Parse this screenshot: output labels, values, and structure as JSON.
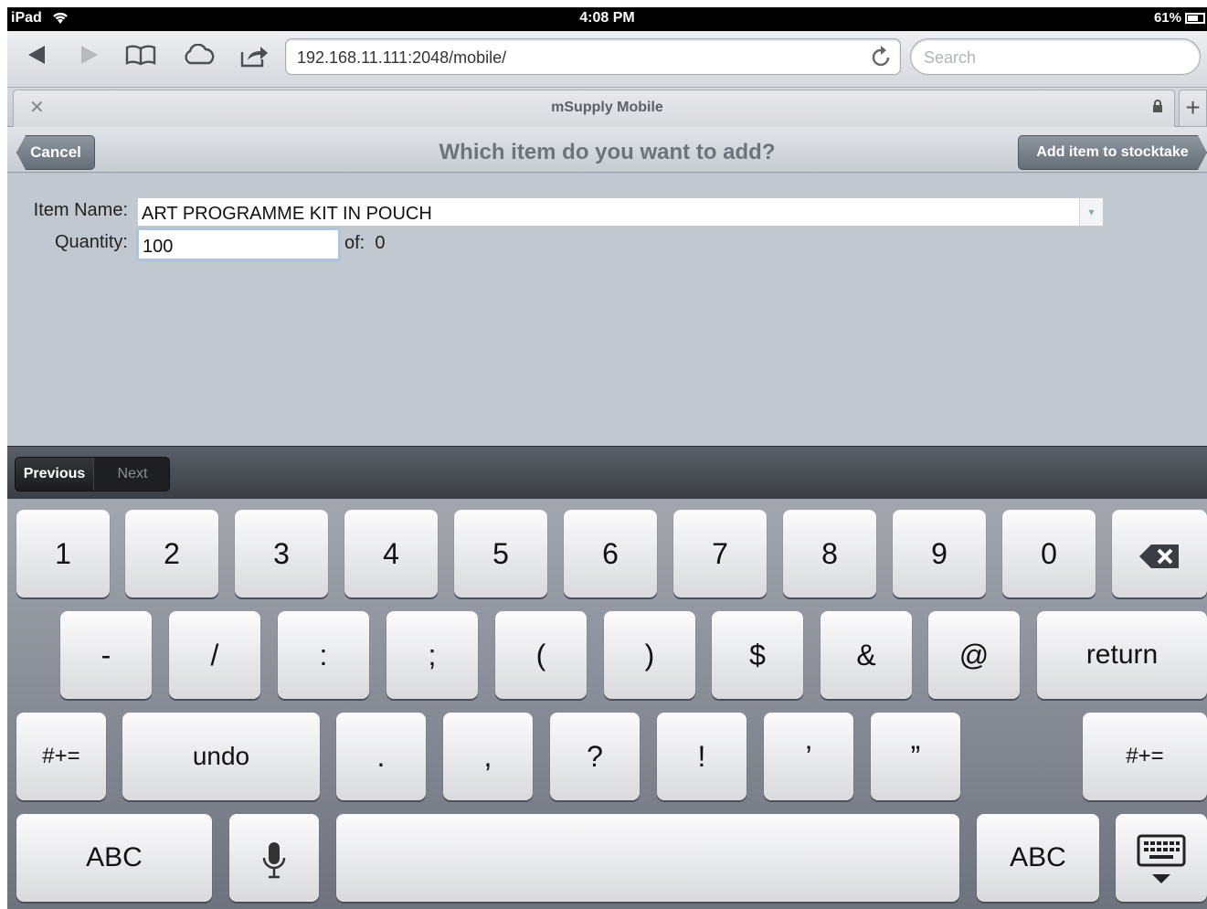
{
  "status_bar": {
    "device": "iPad",
    "time": "4:08 PM",
    "battery": "61%"
  },
  "browser": {
    "url": "192.168.11.111:2048/mobile/",
    "search_placeholder": "Search",
    "tab_title": "mSupply Mobile"
  },
  "page": {
    "cancel_label": "Cancel",
    "heading": "Which item do you want to add?",
    "add_label": "Add item to stocktake"
  },
  "form": {
    "item_name_label": "Item Name:",
    "item_name_value": "ART PROGRAMME KIT IN POUCH",
    "quantity_label": "Quantity:",
    "quantity_value": "100",
    "of_label": "of:",
    "of_value": "0"
  },
  "form_nav": {
    "previous": "Previous",
    "next": "Next"
  },
  "keyboard": {
    "row1": [
      "1",
      "2",
      "3",
      "4",
      "5",
      "6",
      "7",
      "8",
      "9",
      "0"
    ],
    "row2": [
      "-",
      "/",
      ":",
      ";",
      "(",
      ")",
      "$",
      "&",
      "@"
    ],
    "return_label": "return",
    "row3_left": "#+=",
    "undo_label": "undo",
    "row3": [
      ".",
      ",",
      "?",
      "!",
      "’",
      "”"
    ],
    "row3_right": "#+=",
    "abc_left": "ABC",
    "abc_right": "ABC"
  }
}
